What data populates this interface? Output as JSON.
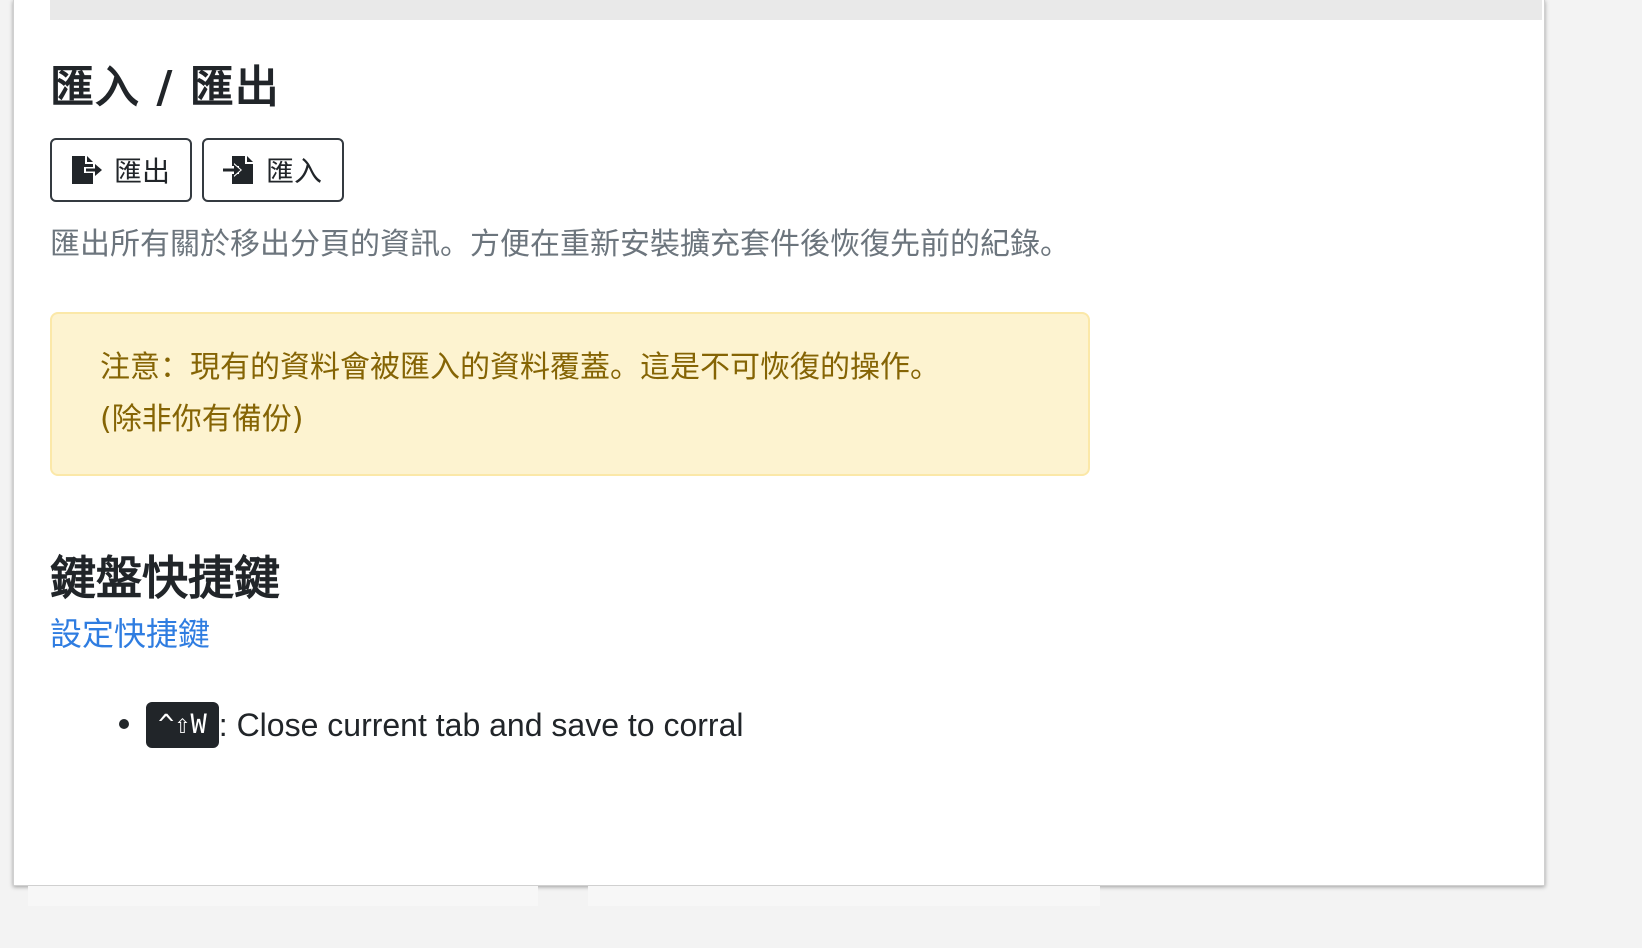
{
  "import_export": {
    "title": "匯入 / 匯出",
    "export_button": {
      "label": "匯出",
      "icon": "file-export-icon"
    },
    "import_button": {
      "label": "匯入",
      "icon": "file-import-icon"
    },
    "description": "匯出所有關於移出分頁的資訊。方便在重新安裝擴充套件後恢復先前的紀錄。",
    "warning": {
      "line1": "注意：現有的資料會被匯入的資料覆蓋。這是不可恢復的操作。",
      "line2": "(除非你有備份)"
    }
  },
  "shortcuts": {
    "title": "鍵盤快捷鍵",
    "configure_link": "設定快捷鍵",
    "items": [
      {
        "keys": "^⇧W",
        "description": ": Close current tab and save to corral"
      }
    ]
  },
  "colors": {
    "link": "#2f7de1",
    "warning_bg": "#fdf3d0",
    "warning_text": "#856404",
    "muted_text": "#6c757d",
    "kbd_bg": "#212529"
  }
}
